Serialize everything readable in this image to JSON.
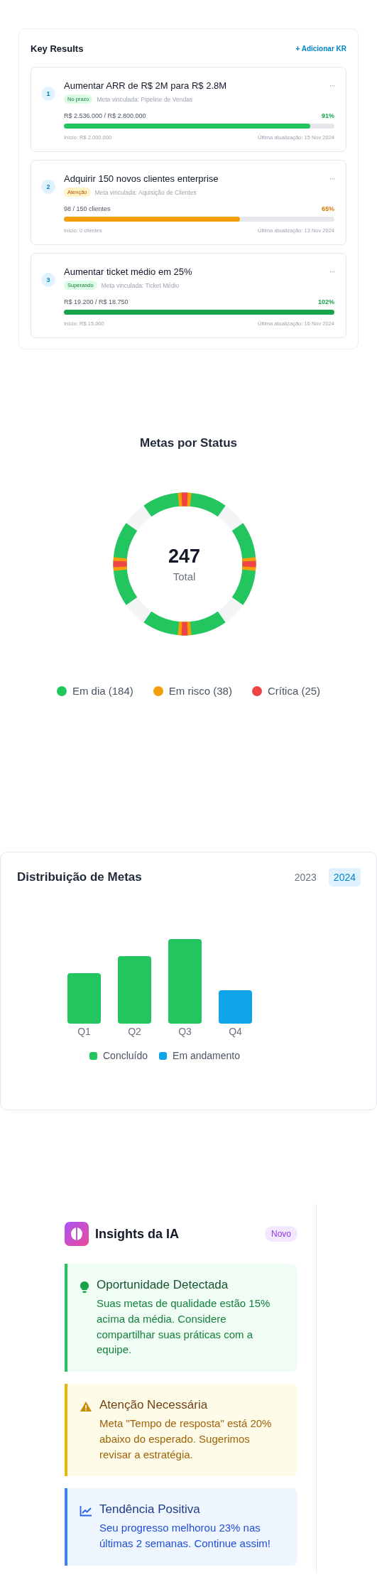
{
  "key_results": {
    "title": "Key Results",
    "add_button": "+ Adicionar KR",
    "items": [
      {
        "number": "1",
        "title": "Aumentar ARR de R$ 2M para R$ 2.8M",
        "kind": "on_track",
        "badge": "No prazo",
        "linked_goal": "Meta vinculada: Pipeline de Vendas",
        "progress_text": "R$ 2.536.000 / R$ 2.800.000",
        "percent": "91%",
        "level": 0.91,
        "start": "Início: R$ 2.000.000",
        "updated": "Última atualização: 15 Nov 2024",
        "menu": "···"
      },
      {
        "number": "2",
        "title": "Adquirir 150 novos clientes enterprise",
        "kind": "attention",
        "badge": "Atenção",
        "linked_goal": "Meta vinculada: Aquisição de Clientes",
        "progress_text": "98 / 150 clientes",
        "percent": "65%",
        "level": 0.65,
        "start": "Início: 0 clientes",
        "updated": "Última atualização: 13 Nov 2024",
        "menu": "···"
      },
      {
        "number": "3",
        "title": "Aumentar ticket médio em 25%",
        "kind": "exceeding",
        "badge": "Superando",
        "linked_goal": "Meta vinculada: Ticket Médio",
        "progress_text": "R$ 19.200 / R$ 18.750",
        "percent": "102%",
        "level": 1,
        "start": "Início: R$ 15.000",
        "updated": "Última atualização: 16 Nov 2024",
        "menu": "···"
      }
    ]
  },
  "status_chart": {
    "title": "Metas por Status",
    "total": "247",
    "total_label": "Total",
    "legend": [
      {
        "label": "Em dia (184)",
        "color": "#22c55e"
      },
      {
        "label": "Em risco (38)",
        "color": "#f59e0b"
      },
      {
        "label": "Crítica (25)",
        "color": "#ef4444"
      }
    ]
  },
  "distribution": {
    "title": "Distribuição de Metas",
    "years": [
      {
        "label": "2023",
        "selected": false
      },
      {
        "label": "2024",
        "selected": true
      }
    ],
    "bars": [
      {
        "label": "Q1",
        "color": "#22c55e"
      },
      {
        "label": "Q2",
        "color": "#22c55e"
      },
      {
        "label": "Q3",
        "color": "#22c55e"
      },
      {
        "label": "Q4",
        "color": "#0ea5e9"
      }
    ],
    "legend": [
      {
        "label": "Concluído",
        "color": "#22c55e"
      },
      {
        "label": "Em andamento",
        "color": "#0ea5e9"
      }
    ]
  },
  "insights": {
    "title": "Insights da IA",
    "badge": "Novo",
    "items": [
      {
        "kind": "opportunity",
        "title": "Oportunidade Detectada",
        "text": "Suas metas de qualidade estão 15% acima da média. Considere compartilhar suas práticas com a equipe."
      },
      {
        "kind": "warning",
        "title": "Atenção Necessária",
        "text": "Meta \"Tempo de resposta\" está 20% abaixo do esperado. Sugerimos revisar a estratégia."
      },
      {
        "kind": "trend",
        "title": "Tendência Positiva",
        "text": "Seu progresso melhorou 23% nas últimas 2 semanas. Continue assim!"
      }
    ]
  }
}
